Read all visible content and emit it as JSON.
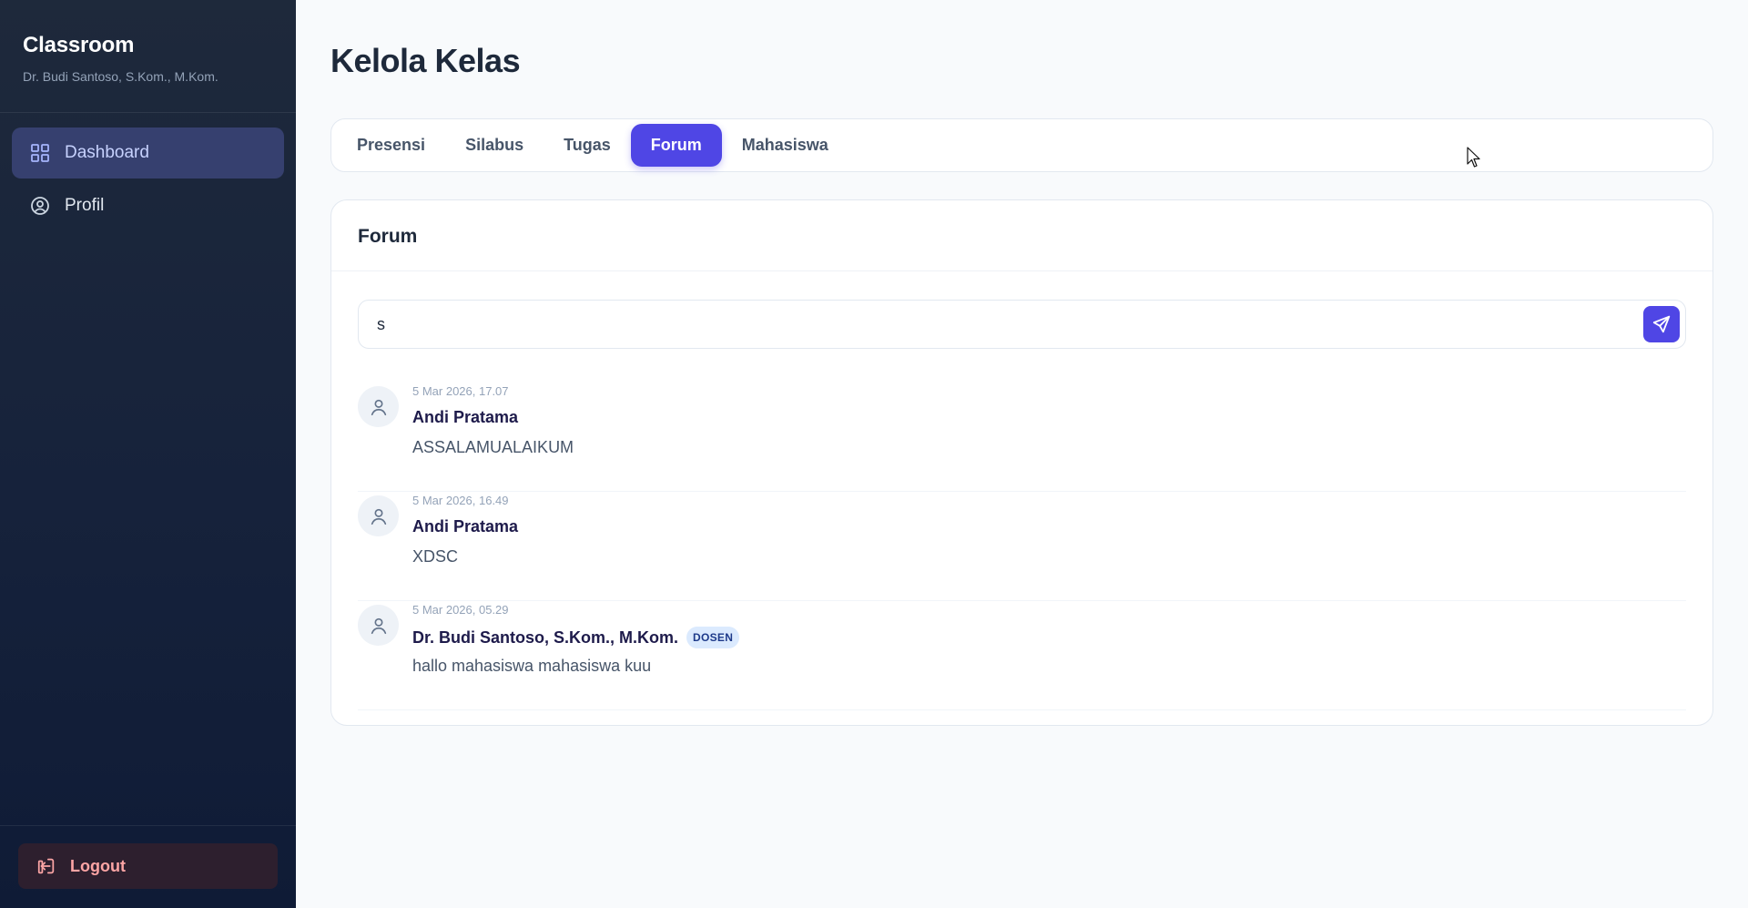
{
  "sidebar": {
    "brand_title": "Classroom",
    "brand_subtitle": "Dr. Budi Santoso, S.Kom., M.Kom.",
    "items": [
      {
        "label": "Dashboard",
        "icon": "grid-icon",
        "active": true
      },
      {
        "label": "Profil",
        "icon": "user-circle-icon",
        "active": false
      }
    ],
    "logout_label": "Logout"
  },
  "main": {
    "page_title": "Kelola Kelas",
    "tabs": [
      {
        "label": "Presensi",
        "active": false
      },
      {
        "label": "Silabus",
        "active": false
      },
      {
        "label": "Tugas",
        "active": false
      },
      {
        "label": "Forum",
        "active": true
      },
      {
        "label": "Mahasiswa",
        "active": false
      }
    ],
    "forum": {
      "title": "Forum",
      "composer_value": "s",
      "send_icon": "send-icon",
      "posts": [
        {
          "timestamp": "5 Mar 2026, 17.07",
          "author": "Andi Pratama",
          "badge": "",
          "body": "ASSALAMUALAIKUM"
        },
        {
          "timestamp": "5 Mar 2026, 16.49",
          "author": "Andi Pratama",
          "badge": "",
          "body": "XDSC"
        },
        {
          "timestamp": "5 Mar 2026, 05.29",
          "author": "Dr. Budi Santoso, S.Kom., M.Kom.",
          "badge": "DOSEN",
          "body": "hallo mahasiswa mahasiswa kuu"
        }
      ]
    }
  },
  "colors": {
    "accent": "#4f46e5",
    "sidebar_bg": "#1e293b",
    "logout_text": "#fca5a5",
    "badge_bg": "#dbeafe"
  }
}
